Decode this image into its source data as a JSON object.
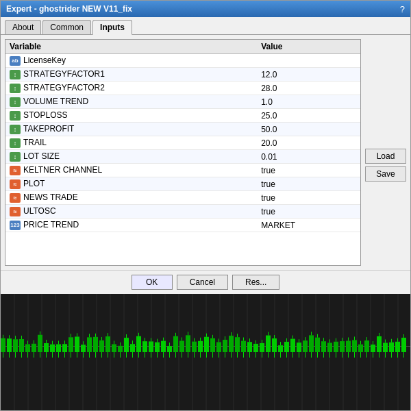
{
  "window": {
    "title": "Expert - ghostrider NEW V11_fix",
    "help_icon": "?"
  },
  "tabs": [
    {
      "id": "about",
      "label": "About",
      "active": false
    },
    {
      "id": "common",
      "label": "Common",
      "active": false
    },
    {
      "id": "inputs",
      "label": "Inputs",
      "active": true
    }
  ],
  "table": {
    "col_variable": "Variable",
    "col_value": "Value",
    "rows": [
      {
        "icon_type": "ab",
        "icon_label": "ab",
        "name": "LicenseKey",
        "value": ""
      },
      {
        "icon_type": "num",
        "icon_label": "1/2",
        "name": "STRATEGYFACTOR1",
        "value": "12.0"
      },
      {
        "icon_type": "num",
        "icon_label": "1/2",
        "name": "STRATEGYFACTOR2",
        "value": "28.0"
      },
      {
        "icon_type": "num",
        "icon_label": "1/2",
        "name": "VOLUME TREND",
        "value": "1.0"
      },
      {
        "icon_type": "num",
        "icon_label": "1/2",
        "name": "STOPLOSS",
        "value": "25.0"
      },
      {
        "icon_type": "num",
        "icon_label": "1/2",
        "name": "TAKEPROFIT",
        "value": "50.0"
      },
      {
        "icon_type": "num",
        "icon_label": "1/2",
        "name": "TRAIL",
        "value": "20.0"
      },
      {
        "icon_type": "num",
        "icon_label": "1/2",
        "name": "LOT SIZE",
        "value": "0.01"
      },
      {
        "icon_type": "bool",
        "icon_label": "~",
        "name": "KELTNER CHANNEL",
        "value": "true"
      },
      {
        "icon_type": "bool",
        "icon_label": "~",
        "name": "PLOT",
        "value": "true"
      },
      {
        "icon_type": "bool",
        "icon_label": "~",
        "name": "NEWS TRADE",
        "value": "true"
      },
      {
        "icon_type": "bool",
        "icon_label": "~",
        "name": "ULTOSC",
        "value": "true"
      },
      {
        "icon_type": "market",
        "icon_label": "123",
        "name": "PRICE TREND",
        "value": "MARKET"
      }
    ]
  },
  "side_buttons": {
    "load": "Load",
    "save": "Save"
  },
  "bottom_buttons": {
    "ok": "OK",
    "cancel": "Cancel",
    "reset": "Res..."
  }
}
